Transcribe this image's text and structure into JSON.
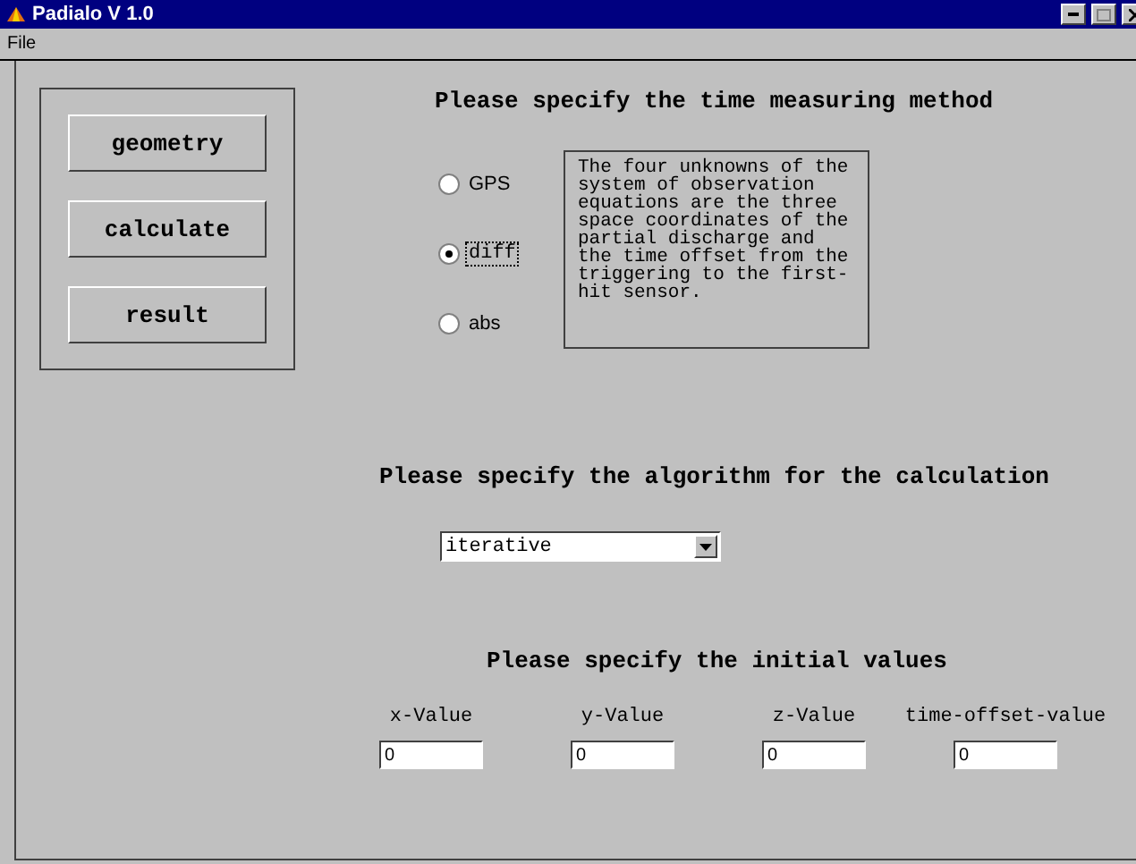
{
  "window": {
    "title": "Padialo V 1.0"
  },
  "menu": [
    "File"
  ],
  "nav_buttons": [
    "geometry",
    "calculate",
    "result"
  ],
  "time_method": {
    "heading": "Please specify the time measuring method",
    "options": [
      {
        "label": "GPS",
        "selected": false,
        "focused": false
      },
      {
        "label": "diff",
        "selected": true,
        "focused": true
      },
      {
        "label": "abs",
        "selected": false,
        "focused": false
      }
    ],
    "info": "The four unknowns of the system of observation equations are the three space coordinates of the partial discharge and the time offset from the triggering to the first-hit sensor."
  },
  "algorithm": {
    "heading": "Please specify the algorithm for the calculation",
    "value": "iterative"
  },
  "initial": {
    "heading": "Please specify the initial values",
    "fields": [
      {
        "label": "x-Value",
        "value": "0"
      },
      {
        "label": "y-Value",
        "value": "0"
      },
      {
        "label": "z-Value",
        "value": "0"
      },
      {
        "label": "time-offset-value",
        "value": "0"
      }
    ]
  }
}
